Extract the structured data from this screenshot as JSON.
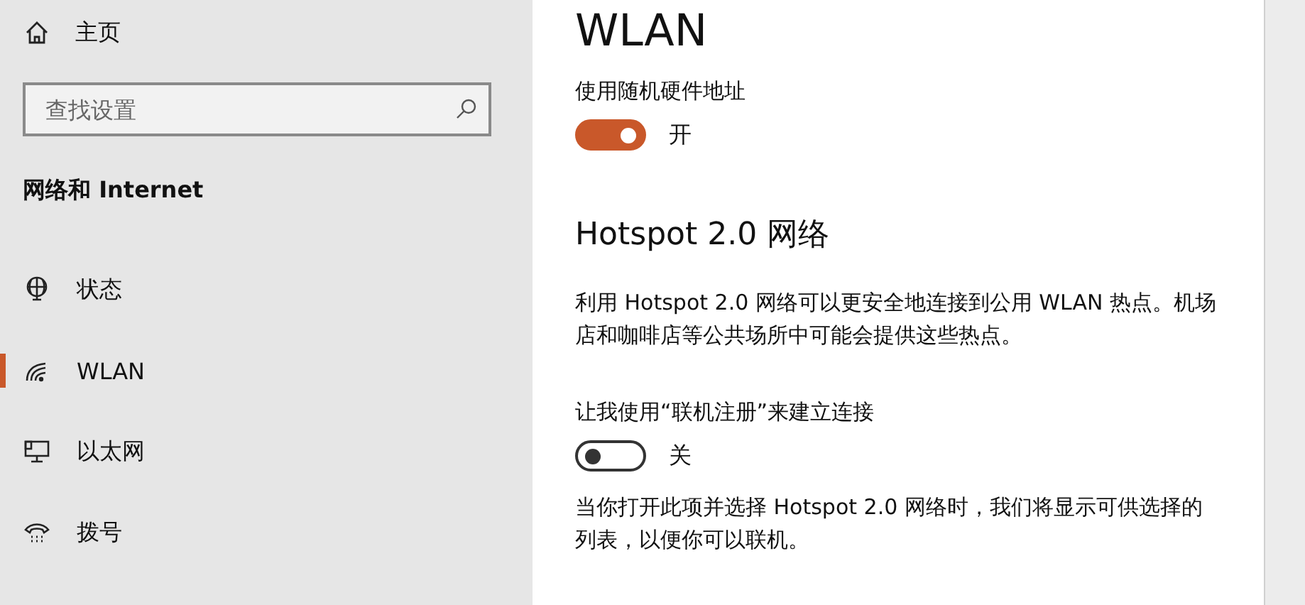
{
  "sidebar": {
    "home": {
      "label": "主页"
    },
    "search": {
      "placeholder": "查找设置"
    },
    "section_title": "网络和 Internet",
    "items": [
      {
        "kind": "status",
        "label": "状态",
        "selected": false
      },
      {
        "kind": "wifi",
        "label": "WLAN",
        "selected": true
      },
      {
        "kind": "ethernet",
        "label": "以太网",
        "selected": false
      },
      {
        "kind": "dialup",
        "label": "拨号",
        "selected": false
      }
    ]
  },
  "content": {
    "title": "WLAN",
    "settings": [
      {
        "kind": "toggle",
        "label": "使用随机硬件地址",
        "on": true,
        "state_text": "开"
      },
      {
        "kind": "heading",
        "text": "Hotspot 2.0 网络"
      },
      {
        "kind": "paragraph",
        "lines": [
          "利用 Hotspot 2.0 网络可以更安全地连接到公用 WLAN 热点。机场",
          "店和咖啡店等公共场所中可能会提供这些热点。"
        ]
      },
      {
        "kind": "toggle",
        "label": "让我使用“联机注册”来建立连接",
        "on": false,
        "state_text": "关"
      },
      {
        "kind": "paragraph",
        "lines": [
          "当你打开此项并选择 Hotspot 2.0 网络时，我们将显示可供选择的",
          "列表，以便你可以联机。"
        ]
      }
    ]
  }
}
